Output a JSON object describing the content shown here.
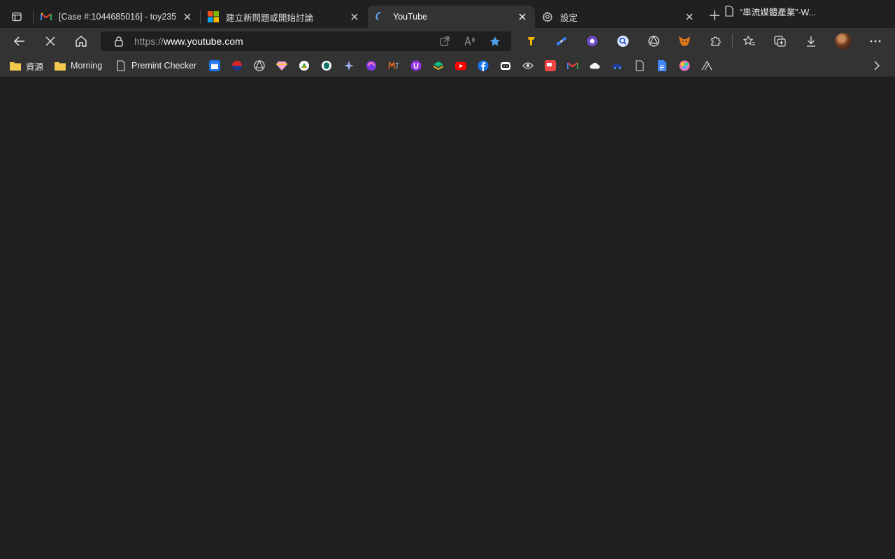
{
  "tabs": [
    {
      "title": "[Case #:1044685016] - toy235",
      "favicon": "gmail-icon",
      "active": false
    },
    {
      "title": "建立新問題或開始討論",
      "favicon": "microsoft-icon",
      "active": false
    },
    {
      "title": "YouTube",
      "favicon": "loading-spinner-icon",
      "active": true
    },
    {
      "title": "設定",
      "favicon": "gear-icon",
      "active": false
    }
  ],
  "address_bar": {
    "scheme": "https://",
    "host": "www.youtube.com"
  },
  "bookmarks": [
    {
      "label": "資源",
      "icon": "folder-icon"
    },
    {
      "label": "Morning",
      "icon": "folder-icon"
    },
    {
      "label": "Premint Checker",
      "icon": "page-icon"
    },
    {
      "label": "“串流媒體產業”-W...",
      "icon": "page-icon"
    }
  ],
  "colors": {
    "tabstrip": "#202020",
    "toolbar": "#333333",
    "page": "#1f1f1f",
    "accent_star": "#4c9fe8"
  }
}
